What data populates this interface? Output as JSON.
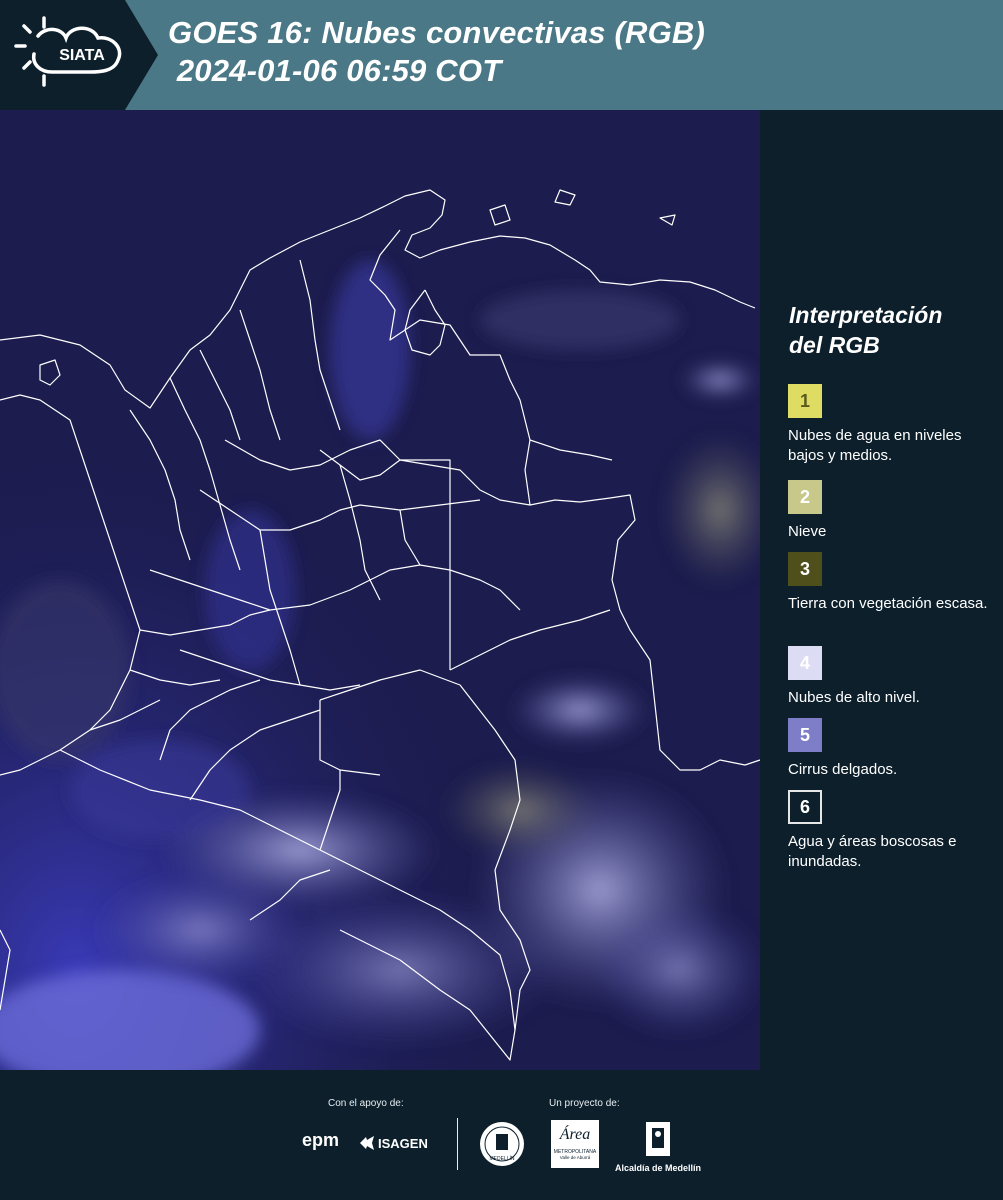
{
  "header": {
    "logo_text": "SIATA",
    "title_line1": "GOES 16: Nubes convectivas (RGB)",
    "title_line2": " 2024-01-06 06:59 COT",
    "bg_color": "#4a7886",
    "logo_bg_color": "#0c1f2b"
  },
  "map": {
    "region": "Colombia",
    "background_color": "#1b1b4d",
    "border_color": "#ffffff"
  },
  "legend": {
    "title_line1": "Interpretación",
    "title_line2": "del RGB",
    "items": [
      {
        "num": "1",
        "label": "Nubes de agua en niveles bajos y medios.",
        "color": "#dedc63",
        "text_color": "#5a5a1e"
      },
      {
        "num": "2",
        "label": "Nieve",
        "color": "#c8c88a",
        "text_color": "#ffffff"
      },
      {
        "num": "3",
        "label": "Tierra con vegetación escasa.",
        "color": "#4f4f1c",
        "text_color": "#ffffff"
      },
      {
        "num": "4",
        "label": "Nubes de alto nivel.",
        "color": "#dcdcf5",
        "text_color": "#ffffff"
      },
      {
        "num": "5",
        "label": "Cirrus delgados.",
        "color": "#7e7ec8",
        "text_color": "#ffffff"
      },
      {
        "num": "6",
        "label": "Agua y áreas boscosas e inundadas.",
        "color": "#0c1f2b",
        "text_color": "#ffffff"
      }
    ]
  },
  "footer": {
    "support_label": "Con el apoyo de:",
    "project_label": "Un proyecto de:",
    "epm_text": "epm",
    "isagen_text": "ISAGEN",
    "medellin_seal_text": "MEDELLÍN",
    "area_text": "Área",
    "area_sub_text": "METROPOLITANA",
    "area_sub_text2": "Valle de Aburrá",
    "alcaldia_text": "Alcaldía de Medellín"
  }
}
